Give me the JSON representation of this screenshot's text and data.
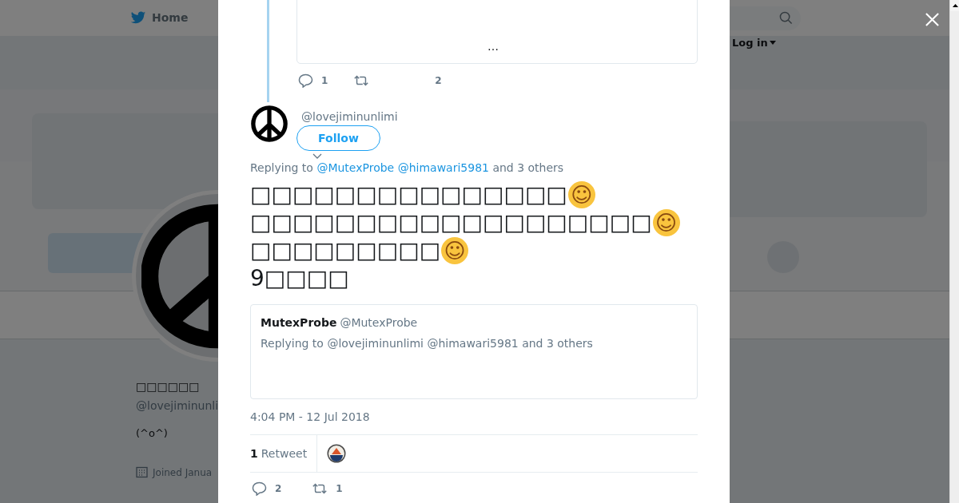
{
  "nav": {
    "home": "Home",
    "login": "Log in"
  },
  "profile": {
    "name": "□□□□□□",
    "handle": "@lovejiminunli",
    "bio": "(^o^)",
    "joined": "Joined Janua"
  },
  "modal": {
    "previous_tweet": {
      "quote_more": "…",
      "reply_count": "1",
      "like_count": "2"
    },
    "tweet": {
      "handle": "@lovejiminunlimi",
      "follow": "Follow",
      "replying_label": "Replying to",
      "replying_links": [
        "@MutexProbe",
        "@himawari5981"
      ],
      "replying_rest": "and 3 others",
      "lines": [
        {
          "text": "□□□□□□□□□□□□□□□",
          "emoji": "☺"
        },
        {
          "text": "□□□□□□□□□□□□□□□□□□□",
          "emoji": "☺"
        },
        {
          "text": "□□□□□□□□□",
          "emoji": "☺"
        },
        {
          "text": "9□□□□"
        }
      ],
      "quote": {
        "name": "MutexProbe",
        "handle": "@MutexProbe",
        "text": "Replying to @lovejiminunlimi @himawari5981 and 3 others"
      },
      "timestamp": "4:04 PM - 12 Jul 2018",
      "retweets": {
        "count": "1",
        "label": "Retweet"
      },
      "reply_count": "2",
      "retweet_count": "1"
    }
  }
}
